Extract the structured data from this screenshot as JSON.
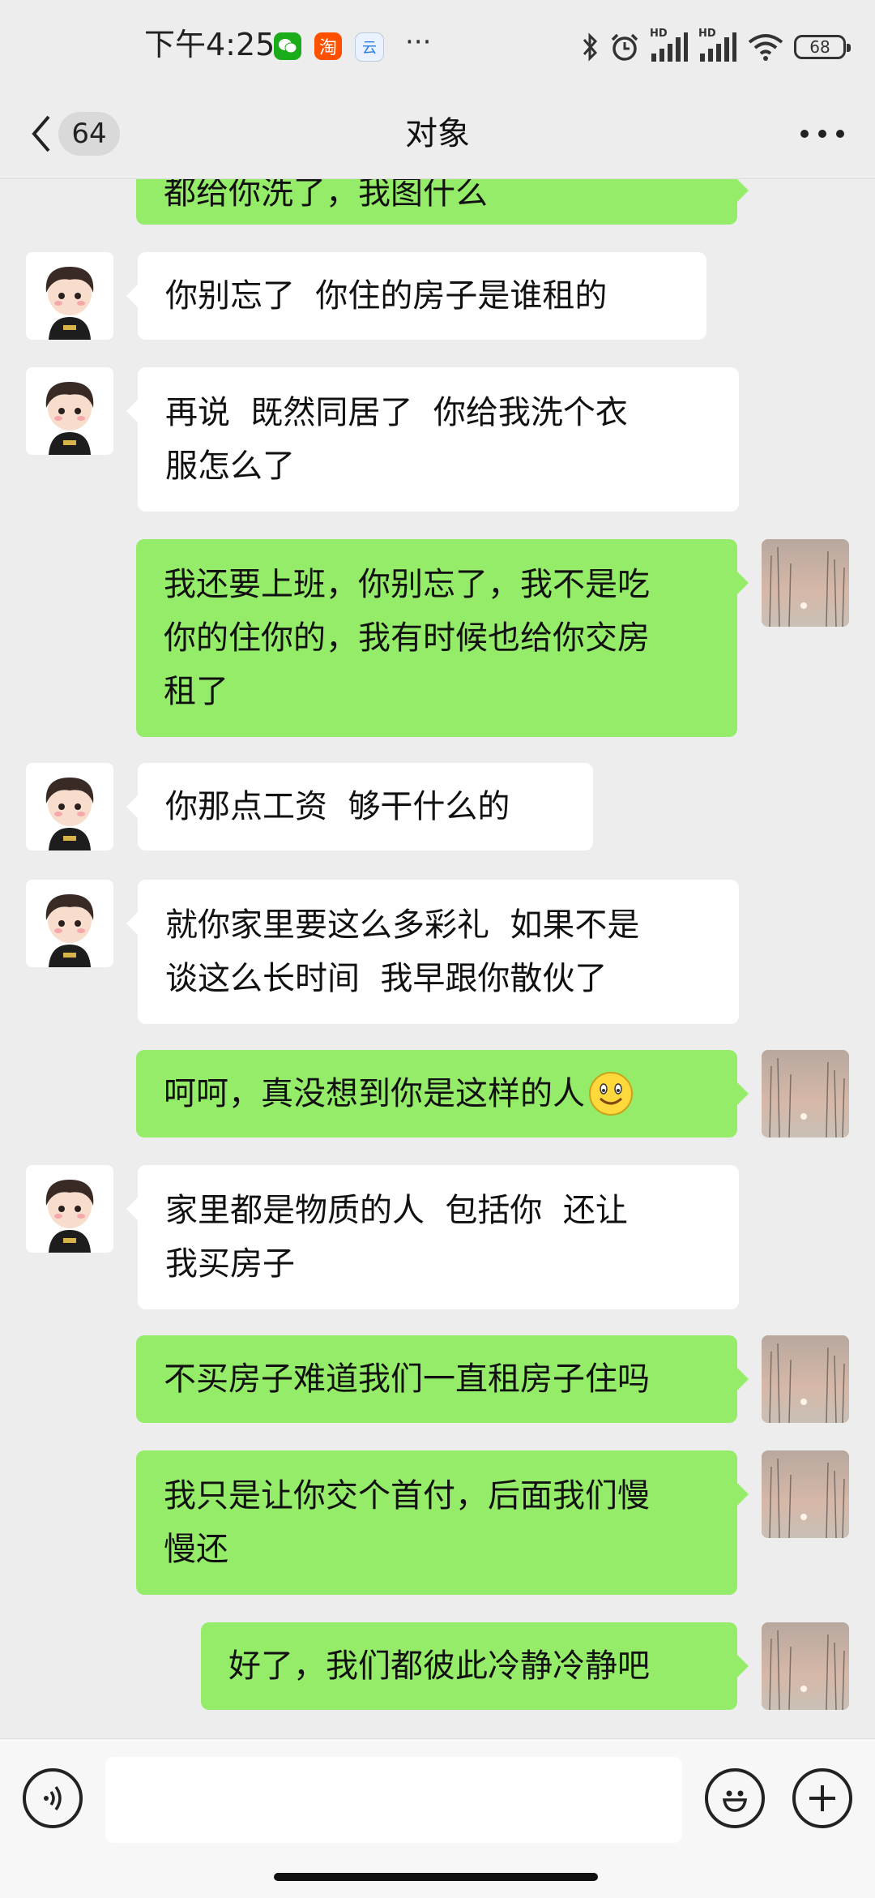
{
  "status_bar": {
    "time": "下午4:25",
    "battery": "68",
    "app_icons": [
      "wechat-icon",
      "taobao-icon",
      "cloud-app-icon"
    ],
    "network_label": "HD",
    "overflow": "···"
  },
  "header": {
    "back_count": "64",
    "title": "对象",
    "more": "···"
  },
  "messages": [
    {
      "side": "out",
      "text": "都给你洗了，我图什么"
    },
    {
      "side": "in",
      "text": "你别忘了  你住的房子是谁租的"
    },
    {
      "side": "in",
      "text": "再说  既然同居了  你给我洗个衣\n服怎么了"
    },
    {
      "side": "out",
      "text": "我还要上班，你别忘了，我不是吃\n你的住你的，我有时候也给你交房\n租了"
    },
    {
      "side": "in",
      "text": "你那点工资  够干什么的"
    },
    {
      "side": "in",
      "text": "就你家里要这么多彩礼  如果不是\n谈这么长时间  我早跟你散伙了"
    },
    {
      "side": "out",
      "text": "呵呵，真没想到你是这样的人",
      "emoji": "smile-emoji"
    },
    {
      "side": "in",
      "text": "家里都是物质的人  包括你  还让\n我买房子"
    },
    {
      "side": "out",
      "text": "不买房子难道我们一直租房子住吗"
    },
    {
      "side": "out",
      "text": "我只是让你交个首付，后面我们慢\n慢还"
    },
    {
      "side": "out",
      "text": "好了，我们都彼此冷静冷静吧"
    }
  ],
  "input_bar": {
    "voice_icon": "voice-icon",
    "emoji_icon": "emoji-icon",
    "add_icon": "plus-icon",
    "input_value": ""
  },
  "colors": {
    "background": "#ededed",
    "bubble_out": "#95ec69",
    "bubble_in": "#ffffff"
  }
}
